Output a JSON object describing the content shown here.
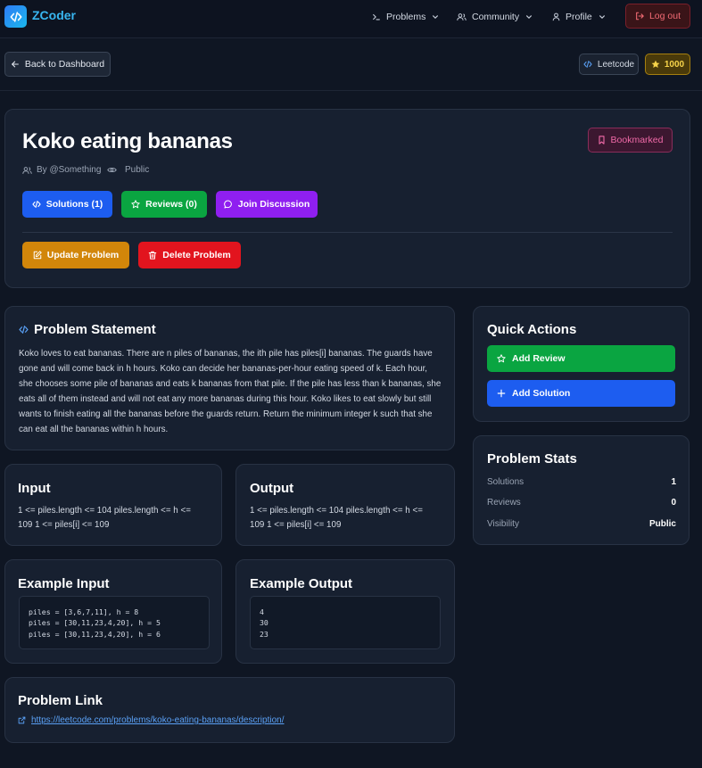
{
  "nav": {
    "brand": "ZCoder",
    "items": [
      {
        "label": "Problems"
      },
      {
        "label": "Community"
      },
      {
        "label": "Profile"
      }
    ],
    "logout_label": "Log out"
  },
  "subbar": {
    "back_label": "Back to Dashboard",
    "platform": "Leetcode",
    "points": "1000"
  },
  "problem": {
    "title": "Koko eating bananas",
    "bookmark_label": "Bookmarked",
    "author": "By @Something",
    "visibility": "Public",
    "solutions_btn": "Solutions (1)",
    "reviews_btn": "Reviews (0)",
    "discussion_btn": "Join Discussion",
    "update_btn": "Update Problem",
    "delete_btn": "Delete Problem"
  },
  "statement": {
    "heading": "Problem Statement",
    "lines": [
      "Koko loves to eat bananas. There are n piles of bananas, the ith pile has piles[i] bananas. The guards have",
      "gone and will come back in h hours. Koko can decide her bananas-per-hour eating speed of k. Each hour,",
      "she chooses some pile of bananas and eats k bananas from that pile. If the pile has less than k bananas, she",
      "eats all of them instead and will not eat any more bananas during this hour. Koko likes to eat slowly but still",
      "wants to finish eating all the bananas before the guards return. Return the minimum integer k such that she",
      "can eat all the bananas within h hours."
    ]
  },
  "input": {
    "heading": "Input",
    "lines": [
      "1 <= piles.length <= 104 piles.length <= h <=",
      "109 1 <= piles[i] <= 109"
    ]
  },
  "output": {
    "heading": "Output",
    "lines": [
      "1 <= piles.length <= 104 piles.length <= h <=",
      "109 1 <= piles[i] <= 109"
    ]
  },
  "example_input": {
    "heading": "Example Input",
    "lines": [
      "piles = [3,6,7,11], h = 8",
      "piles = [30,11,23,4,20], h = 5",
      "piles = [30,11,23,4,20], h = 6"
    ]
  },
  "example_output": {
    "heading": "Example Output",
    "lines": [
      "4",
      "30",
      "23"
    ]
  },
  "problem_link": {
    "heading": "Problem Link",
    "url": "https://leetcode.com/problems/koko-eating-bananas/description/"
  },
  "quick_actions": {
    "heading": "Quick Actions",
    "add_review": "Add Review",
    "add_solution": "Add Solution"
  },
  "stats": {
    "heading": "Problem Stats",
    "rows": [
      {
        "label": "Solutions",
        "value": "1"
      },
      {
        "label": "Reviews",
        "value": "0"
      },
      {
        "label": "Visibility",
        "value": "Public"
      }
    ]
  },
  "colors": {
    "background": "#0f1623",
    "card": "#172030",
    "blue": "#1d5df0",
    "green": "#0aa541",
    "purple": "#8f1ff0",
    "amber": "#d2860a",
    "red": "#e2141e"
  }
}
